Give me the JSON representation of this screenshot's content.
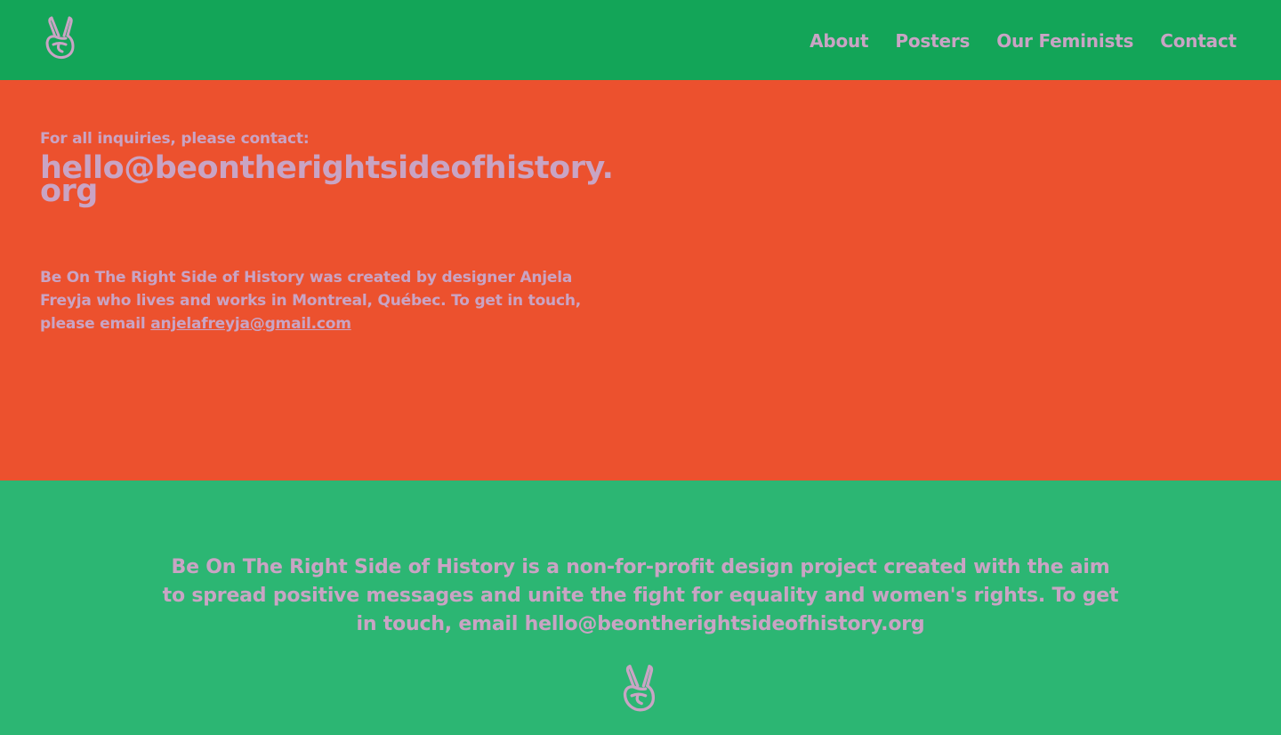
{
  "header": {
    "logo_icon": "peace-hand-icon",
    "nav": [
      "About",
      "Posters",
      "Our Feminists",
      "Contact"
    ]
  },
  "contact": {
    "inquiry_label": "For all inquiries, please contact:",
    "email": "hello@beontherightsideofhistory.org",
    "about_text": "Be On The Right Side of History was created by designer Anjela Freyja who lives and works in Montreal, Québec. To get in touch, please email ",
    "about_email": "anjelafreyja@gmail.com "
  },
  "footer": {
    "text": "Be On The Right Side of History is a non-for-profit design project created with the aim to spread positive messages and unite the fight for equality and women's rights. To get in touch, email hello@beontherightsideofhistory.org",
    "logo_icon": "peace-hand-icon"
  },
  "colors": {
    "header_bg": "#13a558",
    "main_bg": "#ec512e",
    "footer_bg": "#2cb673",
    "text": "#c9a4c4"
  }
}
